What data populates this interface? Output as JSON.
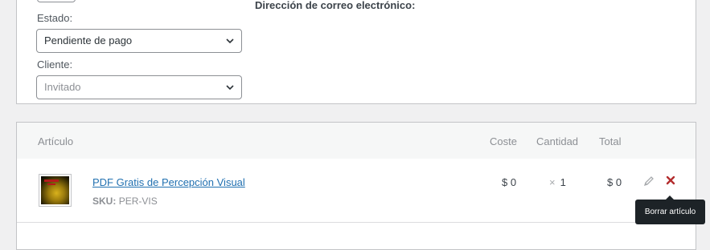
{
  "order_details": {
    "status_label": "Estado:",
    "status_value": "Pendiente de pago",
    "customer_label": "Cliente:",
    "customer_placeholder": "Invitado",
    "email_label": "Dirección de correo electrónico:"
  },
  "items": {
    "headers": {
      "item": "Artículo",
      "cost": "Coste",
      "quantity": "Cantidad",
      "total": "Total"
    },
    "rows": [
      {
        "name": "PDF Gratis de Percepción Visual",
        "sku_label": "SKU:",
        "sku_value": "PER-VIS",
        "cost": "$ 0",
        "qty_symbol": "×",
        "qty": "1",
        "total": "$ 0"
      }
    ]
  },
  "tooltip": {
    "text": "Borrar artículo"
  },
  "icons": {
    "chevron": "chevron-down-icon",
    "edit": "pencil-icon",
    "delete": "close-icon"
  },
  "colors": {
    "link": "#2271b1",
    "delete": "#b32d2e",
    "tooltip_bg": "#1d2327"
  }
}
